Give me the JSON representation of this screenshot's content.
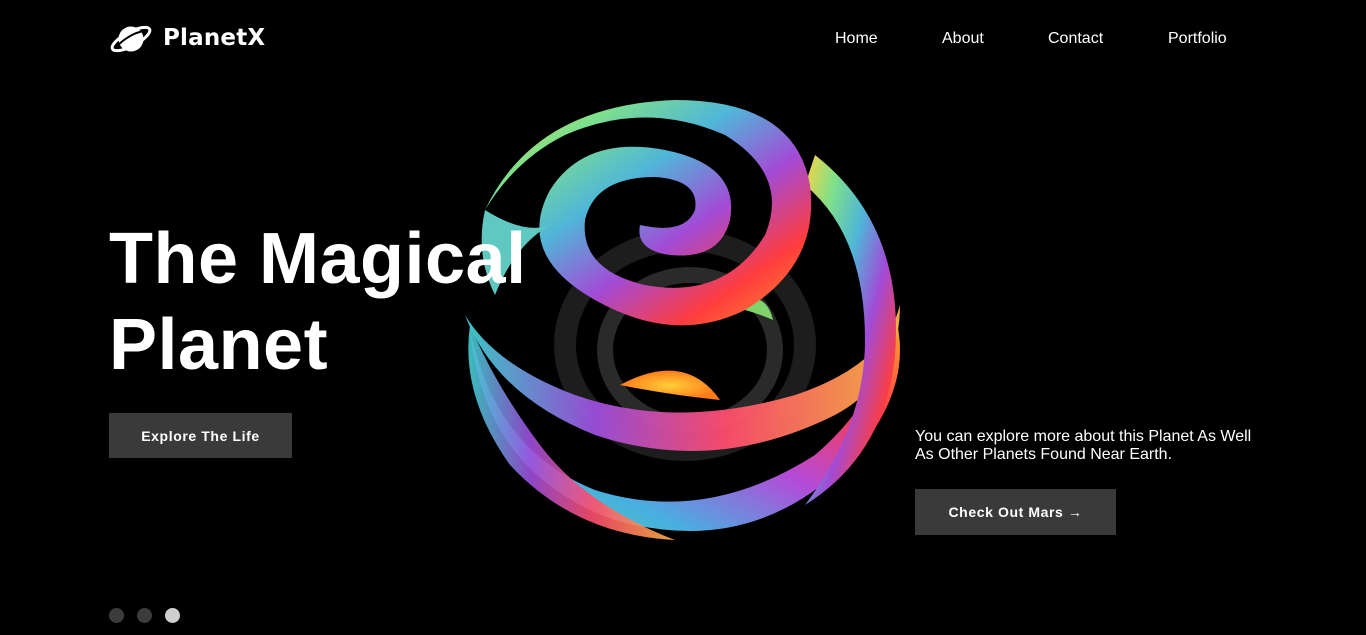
{
  "brand": {
    "name": "PlanetX",
    "icon": "planet-ring-icon"
  },
  "nav": {
    "items": [
      {
        "label": "Home"
      },
      {
        "label": "About"
      },
      {
        "label": "Contact"
      },
      {
        "label": "Portfolio"
      }
    ]
  },
  "hero": {
    "title_line1": "The Magical",
    "title_line2": "Planet",
    "primary_button": "Explore The Life",
    "description_line1": "You can explore more about this Planet As Well",
    "description_line2": "As Other Planets Found Near Earth.",
    "secondary_button": "Check Out Mars →",
    "illustration": "rainbow-ribbon-sphere"
  },
  "carousel": {
    "slide_count": 3,
    "active_index": 2
  },
  "colors": {
    "background": "#000000",
    "button_bg": "#3a3a3a",
    "text": "#ffffff",
    "dot_inactive": "#3c3c3c",
    "dot_active": "#cfcfcf"
  }
}
